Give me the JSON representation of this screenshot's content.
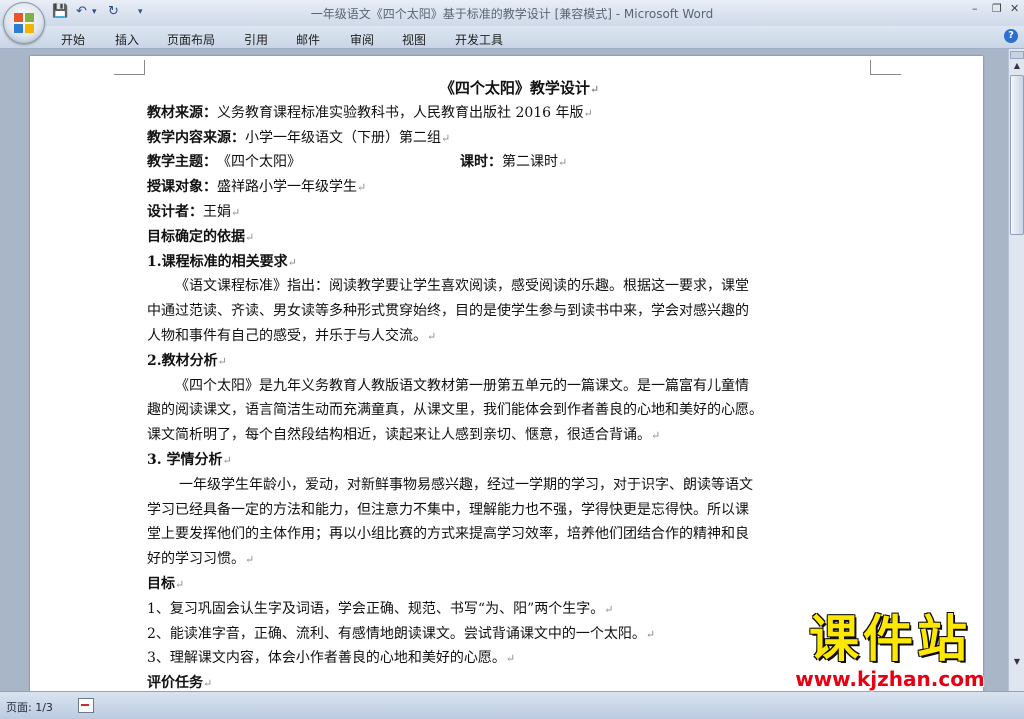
{
  "window": {
    "title": "一年级语文《四个太阳》基于标准的教学设计 [兼容模式] - Microsoft Word",
    "controls": {
      "minimize": "–",
      "restore": "❐",
      "close": "✕"
    }
  },
  "quick_access": {
    "save_icon": "save-icon",
    "undo_icon": "undo-icon",
    "redo_icon": "redo-icon"
  },
  "ribbon": {
    "tabs": [
      "开始",
      "插入",
      "页面布局",
      "引用",
      "邮件",
      "审阅",
      "视图",
      "开发工具"
    ],
    "help": "?"
  },
  "document": {
    "lines": [
      {
        "type": "title",
        "text": "《四个太阳》教学设计"
      },
      {
        "type": "kv",
        "label": "教材来源：",
        "value": "义务教育课程标准实验教科书，人民教育出版社 2016 年版"
      },
      {
        "type": "kv",
        "label": "教学内容来源：",
        "value": "小学一年级语文（下册）第二组"
      },
      {
        "type": "kv2",
        "label": "教学主题：",
        "value": "《四个太阳》",
        "label2": "课时：",
        "value2": "第二课时"
      },
      {
        "type": "kv",
        "label": "授课对象：",
        "value": "盛祥路小学一年级学生"
      },
      {
        "type": "kv",
        "label": "设计者：",
        "value": "王娟"
      },
      {
        "type": "heading",
        "text": "目标确定的依据"
      },
      {
        "type": "heading",
        "text": "1.课程标准的相关要求"
      },
      {
        "type": "para",
        "text": "《语文课程标准》指出：阅读教学要让学生喜欢阅读，感受阅读的乐趣。根据这一要求，课堂"
      },
      {
        "type": "plain",
        "text": "中通过范读、齐读、男女读等多种形式贯穿始终，目的是使学生参与到读书中来，学会对感兴趣的"
      },
      {
        "type": "plain",
        "text": "人物和事件有自己的感受，并乐于与人交流。"
      },
      {
        "type": "heading",
        "text": "2.教材分析"
      },
      {
        "type": "para",
        "text": "《四个太阳》是九年义务教育人教版语文教材第一册第五单元的一篇课文。是一篇富有儿童情"
      },
      {
        "type": "plain",
        "text": "趣的阅读课文，语言简洁生动而充满童真，从课文里，我们能体会到作者善良的心地和美好的心愿。"
      },
      {
        "type": "plain",
        "text": "课文简析明了，每个自然段结构相近，读起来让人感到亲切、惬意，很适合背诵。"
      },
      {
        "type": "heading",
        "text": "3. 学情分析"
      },
      {
        "type": "para2",
        "text": "一年级学生年龄小，爱动，对新鲜事物易感兴趣，经过一学期的学习，对于识字、朗读等语文"
      },
      {
        "type": "plain",
        "text": "学习已经具备一定的方法和能力，但注意力不集中，理解能力也不强，学得快更是忘得快。所以课"
      },
      {
        "type": "plain",
        "text": "堂上要发挥他们的主体作用；再以小组比赛的方式来提高学习效率，培养他们团结合作的精神和良"
      },
      {
        "type": "plain",
        "text": "好的学习习惯。"
      },
      {
        "type": "heading",
        "text": "目标"
      },
      {
        "type": "plain",
        "text": "1、复习巩固会认生字及词语，学会正确、规范、书写“为、阳”两个生字。"
      },
      {
        "type": "plain",
        "text": "2、能读准字音，正确、流利、有感情地朗读课文。尝试背诵课文中的一个太阳。"
      },
      {
        "type": "plain",
        "text": "3、理解课文内容，体会小作者善良的心地和美好的心愿。"
      },
      {
        "type": "heading",
        "text": "评价任务"
      }
    ],
    "paragraph_mark": "↵"
  },
  "status": {
    "page": "页面: 1/3"
  },
  "watermark": {
    "text": "课件站",
    "url": "www.kjzhan.com"
  }
}
